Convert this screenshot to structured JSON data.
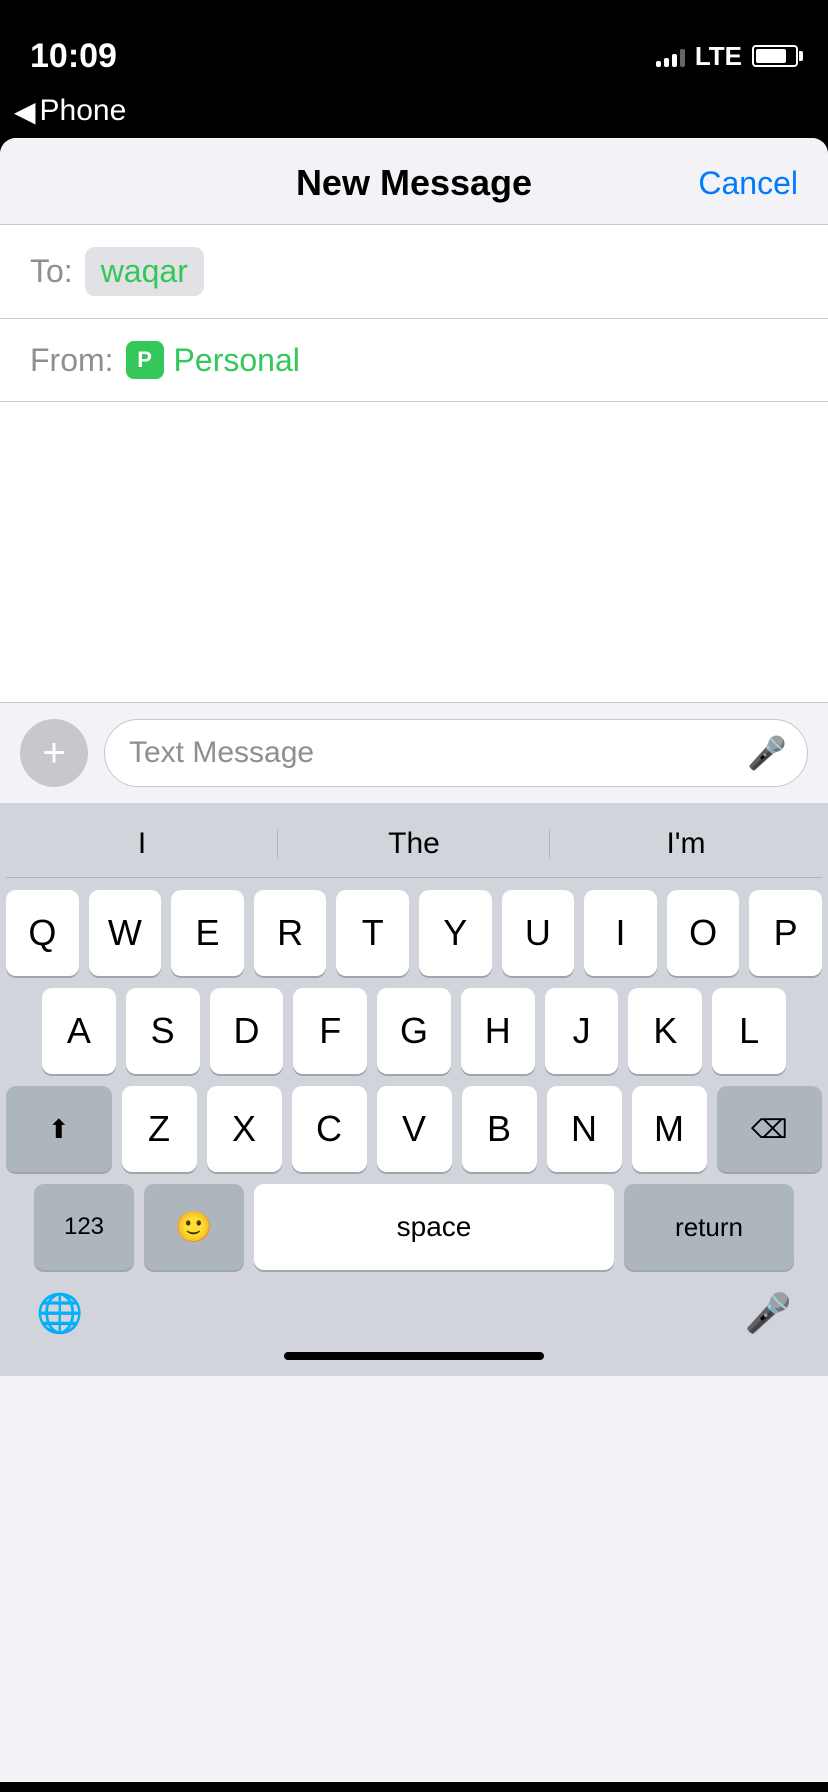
{
  "statusBar": {
    "time": "10:09",
    "carrier": "LTE"
  },
  "nav": {
    "backLabel": "Phone"
  },
  "header": {
    "title": "New Message",
    "cancelLabel": "Cancel"
  },
  "toField": {
    "label": "To:",
    "recipient": "waqar"
  },
  "fromField": {
    "label": "From:",
    "iconLetter": "P",
    "accountName": "Personal"
  },
  "inputBar": {
    "addIcon": "+",
    "placeholder": "Text Message"
  },
  "autocomplete": {
    "words": [
      "I",
      "The",
      "I'm"
    ]
  },
  "keyboard": {
    "row1": [
      "Q",
      "W",
      "E",
      "R",
      "T",
      "Y",
      "U",
      "I",
      "O",
      "P"
    ],
    "row2": [
      "A",
      "S",
      "D",
      "F",
      "G",
      "H",
      "J",
      "K",
      "L"
    ],
    "row3": [
      "Z",
      "X",
      "C",
      "V",
      "B",
      "N",
      "M"
    ],
    "spaceLabel": "space",
    "returnLabel": "return",
    "numbersLabel": "123"
  }
}
